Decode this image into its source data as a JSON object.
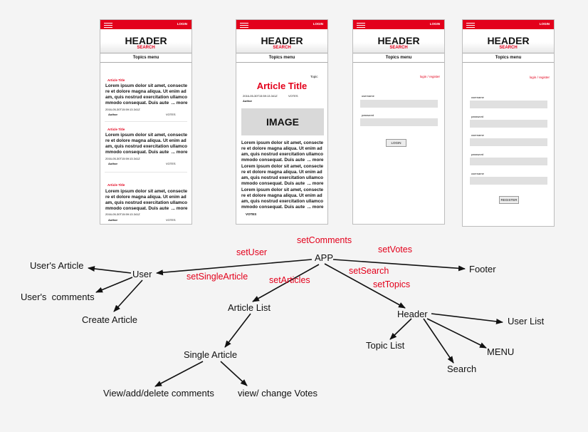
{
  "mockup": {
    "login_top": "LOGIN",
    "header": "HEADER",
    "search": "SEARCH",
    "topics_menu": "Topics menu",
    "article_title": "Article Title",
    "lorem": [
      "Lorem ipsum dolor sit amet, consecte",
      "re et dolore magna aliqua. Ut enim ad",
      "am, quis nostrud exercitation ullamco",
      "mmodo consequat. Duis aute"
    ],
    "more": "... more",
    "date": "2016-05-30T15:59:13.341Z",
    "author": "Author",
    "votes_small": "VOTES",
    "topic": "Topic",
    "image": "IMAGE",
    "votes": "VOTES",
    "login_register": "login / register",
    "username": "username",
    "password": "password",
    "login_btn": "LOGIN",
    "register_btn": "REGISTER"
  },
  "diagram": {
    "nodes": {
      "app": "APP",
      "user": "User",
      "users_article": "User's Article",
      "users_comments": "User's  comments",
      "create_article": "Create Article",
      "article_list": "Article List",
      "single_article": "Single Article",
      "comments": "View/add/delete comments",
      "votes": "view/ change Votes",
      "header": "Header",
      "topic_list": "Topic List",
      "search": "Search",
      "menu": "MENU",
      "user_list": "User List",
      "footer": "Footer"
    },
    "edges": {
      "set_comments": "setComments",
      "set_user": "setUser",
      "set_votes": "setVotes",
      "set_single_article": "setSingleArticle",
      "set_search": "setSearch",
      "set_articles": "setArticles",
      "set_topics": "setTopics"
    }
  }
}
